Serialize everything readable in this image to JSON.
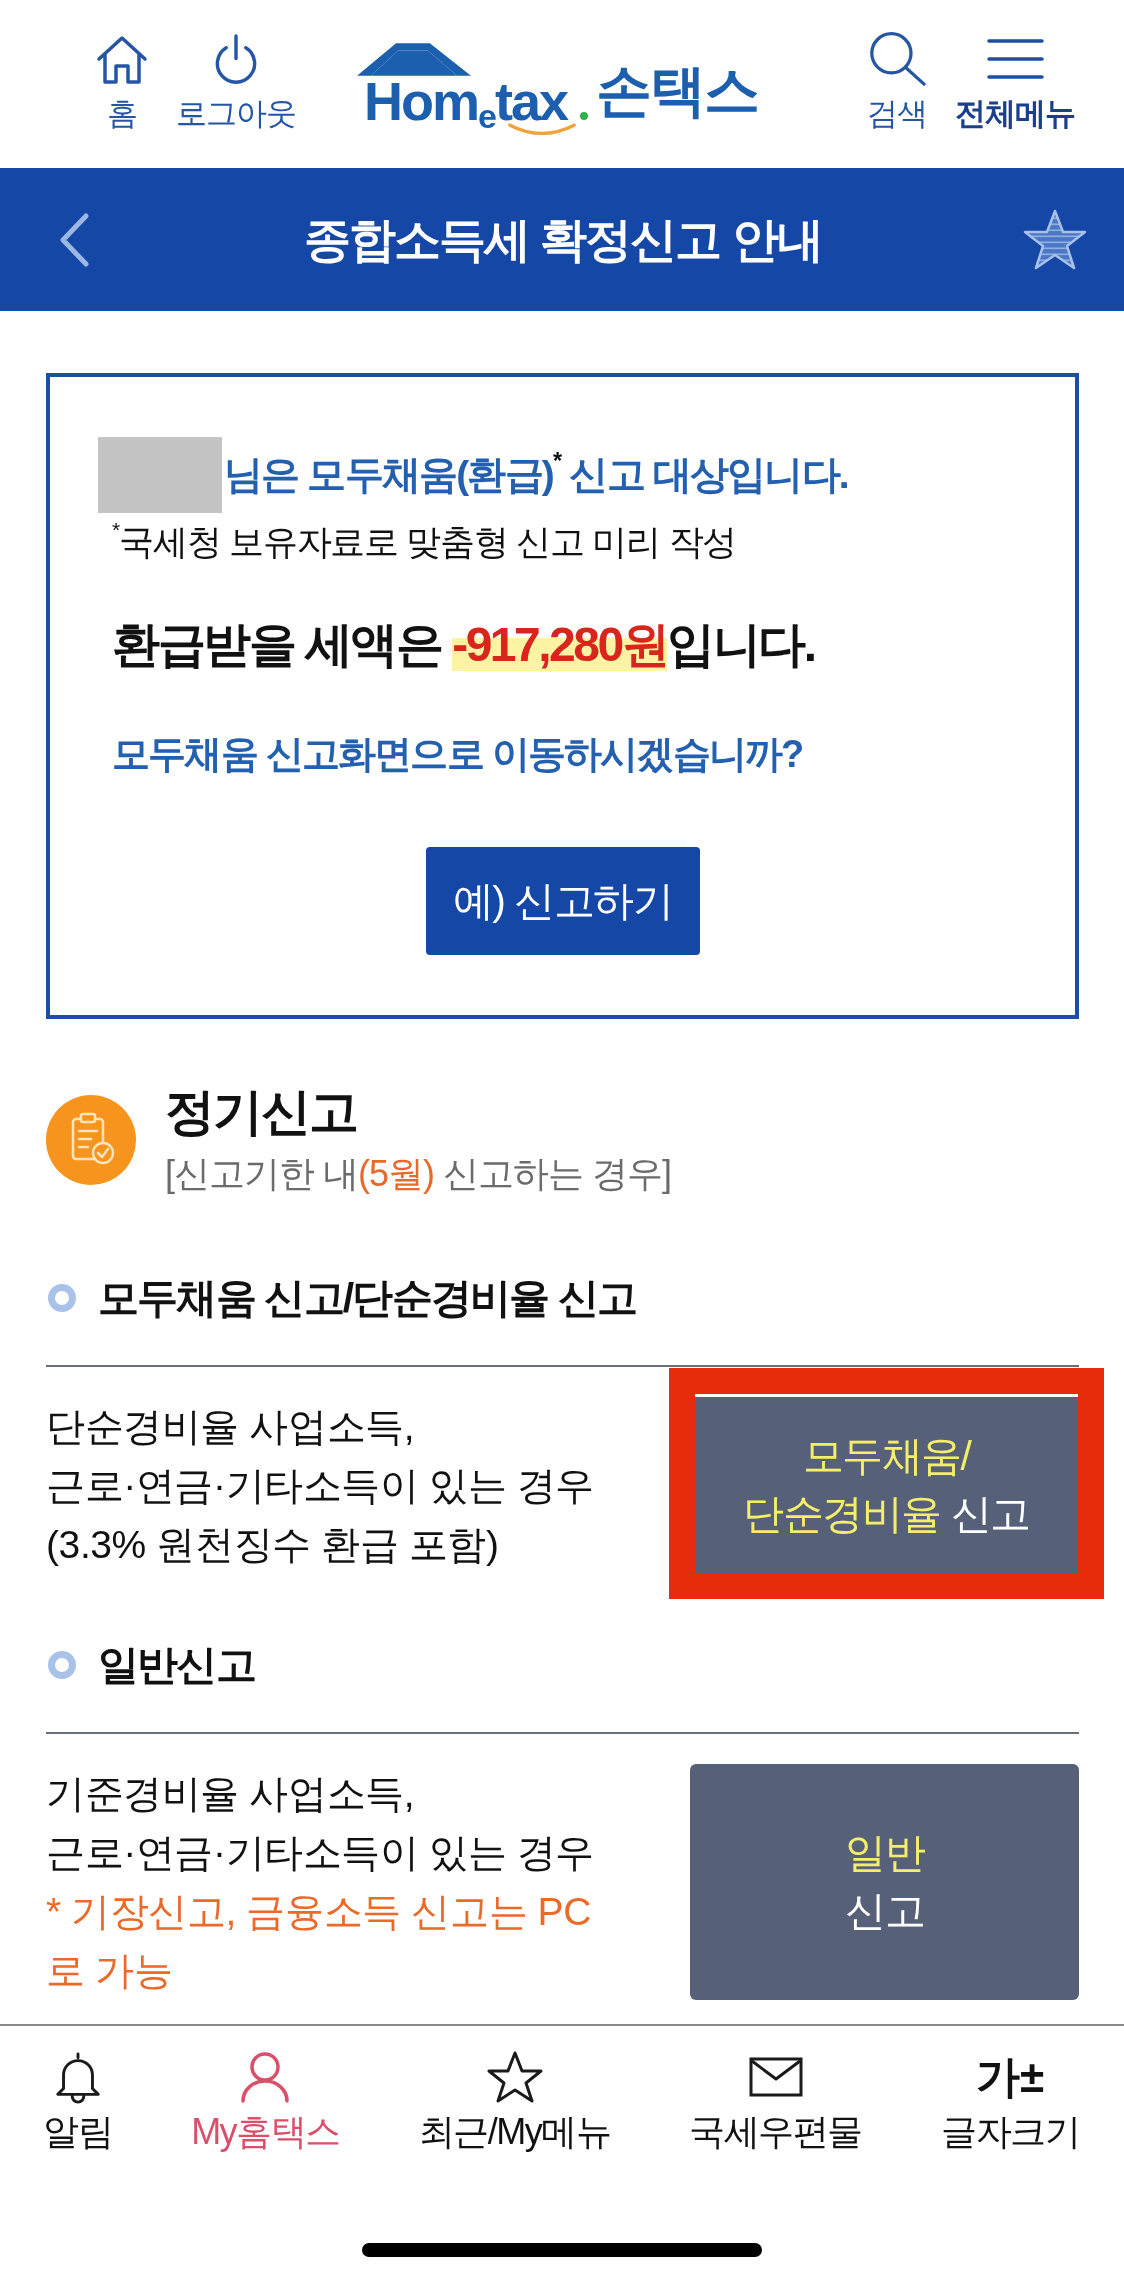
{
  "header": {
    "left_actions": [
      {
        "label": "홈",
        "emphasis": false
      },
      {
        "label": "로그아웃",
        "emphasis": false
      }
    ],
    "logo": {
      "brand": "Hom$_{e}$tax",
      "app_name": "손택스"
    },
    "right_actions": [
      {
        "label": "검색",
        "emphasis": false
      },
      {
        "label": "전체메뉴",
        "emphasis": true
      }
    ]
  },
  "title_bar": {
    "title": "종합소득세 확정신고 안내"
  },
  "notice": {
    "name_masked": true,
    "headline": "님은 모두채움(환급)$^{*}$ 신고 대상입니다.",
    "footnote": "$^{*}$국세청 보유자료로 맞춤형 신고 미리 작성",
    "refund": {
      "prefix": "환급받을 세액은",
      "amount": "-917,280원",
      "suffix": "입니다."
    },
    "question": "모두채움 신고화면으로 이동하시겠습니까?",
    "button": "예) 신고하기"
  },
  "section": {
    "title": "정기신고",
    "subtitle": [
      {
        "text": "[신고기한 내",
        "accent": false
      },
      {
        "text": "(5월)",
        "accent": true
      },
      {
        "text": " 신고하는 경우]",
        "accent": false
      }
    ],
    "groups": [
      {
        "heading": "모두채움 신고/단순경비율 신고",
        "description": [
          "단순경비율 사업소득,",
          "근로·연금·기타소득이 있는 경우",
          "(3.3% 원천징수 환급 포함)"
        ],
        "button": {
          "lines": [
            [
              {
                "text": "모두채움/",
                "accent": true
              }
            ],
            [
              {
                "text": "단순경비율",
                "accent": true
              },
              {
                "text": "신고",
                "accent": false
              }
            ]
          ],
          "highlighted": true
        }
      },
      {
        "heading": "일반신고",
        "description": [
          "기준경비율 사업소득,",
          "근로·연금·기타소득이 있는 경우"
        ],
        "note": "* 기장신고, 금융소득 신고는 PC로 가능",
        "button": {
          "lines": [
            [
              {
                "text": "일반",
                "accent": true
              }
            ],
            [
              {
                "text": "신고",
                "accent": false
              }
            ]
          ],
          "highlighted": false
        }
      }
    ]
  },
  "bottom_nav": {
    "items": [
      {
        "label": "알림",
        "selected": false
      },
      {
        "label": "My홈택스",
        "selected": true
      },
      {
        "label": "최근/My메뉴",
        "selected": false
      },
      {
        "label": "국세우편물",
        "selected": false
      },
      {
        "label": "글자크기",
        "selected": false,
        "icon_text": "가±"
      }
    ]
  }
}
